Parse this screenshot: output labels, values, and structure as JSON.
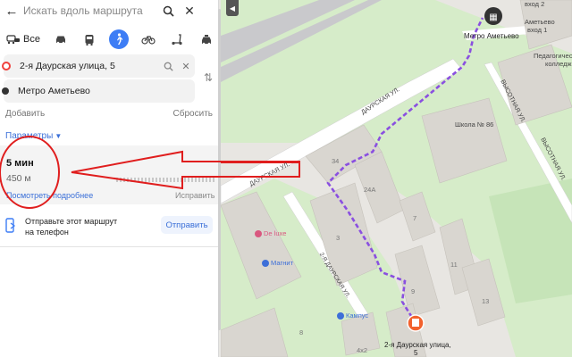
{
  "search": {
    "placeholder": "Искать вдоль маршрута"
  },
  "modes": {
    "all_label": "Все"
  },
  "route_points": {
    "from": "2-я Даурская улица, 5",
    "to": "Метро Аметьево"
  },
  "actions": {
    "add": "Добавить",
    "reset": "Сбросить",
    "params": "Параметры"
  },
  "route": {
    "time": "5 мин",
    "distance": "450 м",
    "details": "Посмотреть подробнее",
    "fix": "Исправить"
  },
  "send": {
    "line1": "Отправьте этот маршрут",
    "line2": "на телефон",
    "button": "Отправить"
  },
  "map": {
    "labels": {
      "street_daurskaya_1": "ДАУРСКАЯ УЛ.",
      "street_daurskaya_2": "ДАУРСКАЯ УЛ.",
      "street_vysotnaya_1": "ВЫСОТНАЯ УЛ.",
      "street_vysotnaya_2": "ВЫСОТНАЯ УЛ.",
      "street_2ya_daurskaya": "2-Я ДАУРСКАЯ УЛ.",
      "school": "Школа № 86",
      "college_1": "Педагогический",
      "college_2": "колледж",
      "metro_entrance_2": "вход 2",
      "metro_entrance_1_a": "Аметьево",
      "metro_entrance_1_b": "вход 1",
      "metro_stop": "Метро Аметьево",
      "destination_1": "2-я Даурская улица,",
      "destination_2": "5",
      "deluxe": "De luxe",
      "magnit": "Магнит",
      "kampus": "Кампус"
    },
    "house_numbers": [
      "34",
      "24А",
      "3",
      "7",
      "11",
      "9",
      "13",
      "4х2",
      "8"
    ],
    "colors": {
      "route": "#8a4fe0",
      "roads": "#ffffff",
      "highway": "#c9c9cc",
      "park": "#d2ecc6",
      "buildings": "#d9d6d0",
      "arrow": "#e01e1e",
      "destination_marker": "#f2622e"
    }
  },
  "colors": {
    "accent": "#3d7df5",
    "link": "#3a6fd8"
  }
}
